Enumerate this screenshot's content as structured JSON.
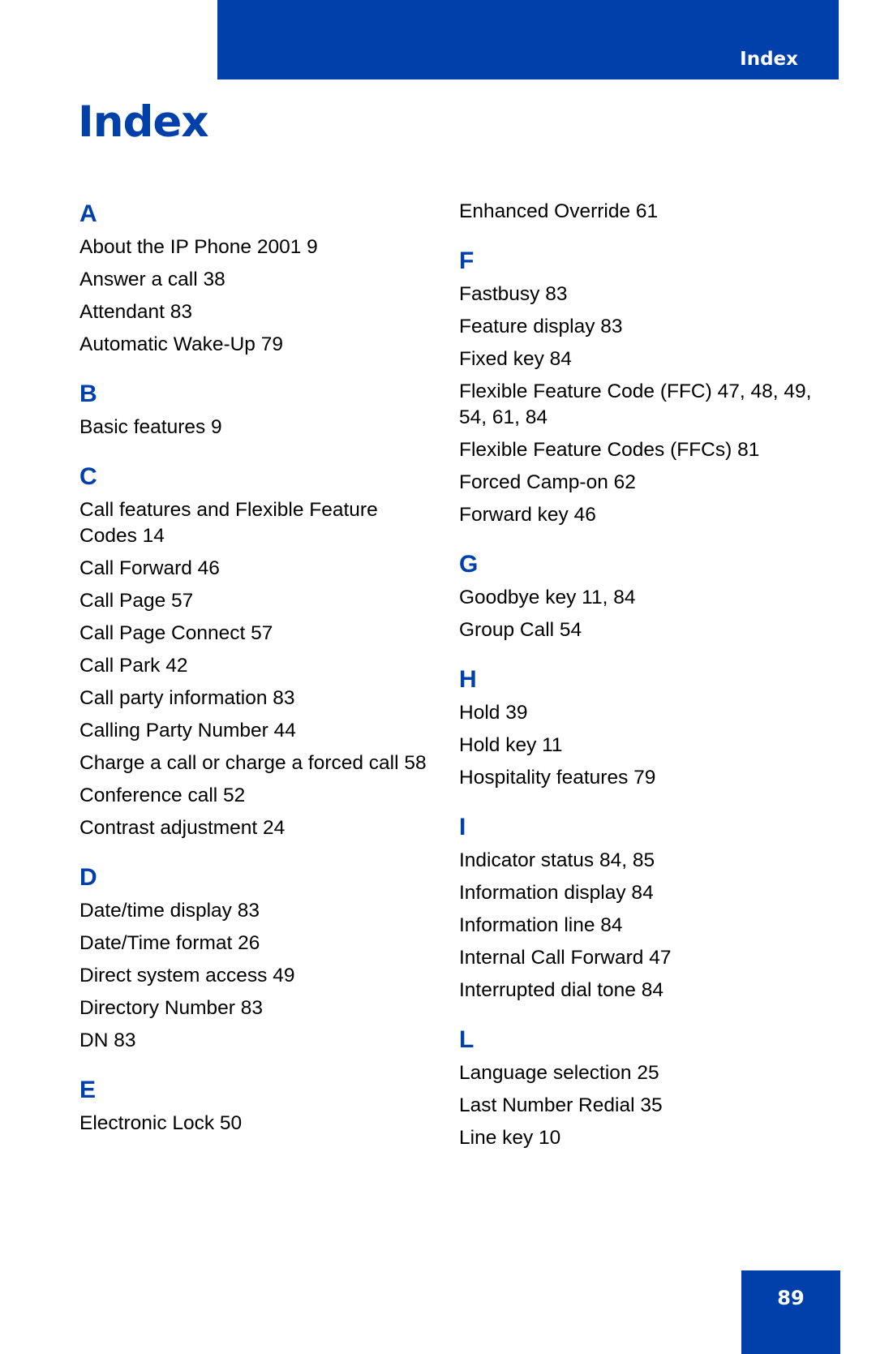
{
  "header": {
    "section_label": "Index"
  },
  "title": "Index",
  "page_number": "89",
  "colors": {
    "brand_blue": "#0040ab"
  },
  "left_column": [
    {
      "letter": "A",
      "entries": [
        "About the IP Phone 2001 9",
        "Answer a call 38",
        "Attendant 83",
        "Automatic Wake-Up 79"
      ]
    },
    {
      "letter": "B",
      "entries": [
        "Basic features 9"
      ]
    },
    {
      "letter": "C",
      "entries": [
        "Call features and Flexible Feature Codes 14",
        "Call Forward 46",
        "Call Page 57",
        "Call Page Connect 57",
        "Call Park 42",
        "Call party information 83",
        "Calling Party Number 44",
        "Charge a call or charge a forced call 58",
        "Conference call 52",
        "Contrast adjustment 24"
      ]
    },
    {
      "letter": "D",
      "entries": [
        "Date/time display 83",
        "Date/Time format 26",
        "Direct system access 49",
        "Directory Number 83",
        "DN 83"
      ]
    },
    {
      "letter": "E",
      "entries": [
        "Electronic Lock 50"
      ]
    }
  ],
  "right_column": [
    {
      "letter": "",
      "entries": [
        "Enhanced Override 61"
      ]
    },
    {
      "letter": "F",
      "entries": [
        "Fastbusy 83",
        "Feature display 83",
        "Fixed key 84",
        "Flexible Feature Code (FFC) 47, 48, 49, 54, 61, 84",
        "Flexible Feature Codes (FFCs) 81",
        "Forced Camp-on 62",
        "Forward key 46"
      ]
    },
    {
      "letter": "G",
      "entries": [
        "Goodbye key 11, 84",
        "Group Call 54"
      ]
    },
    {
      "letter": "H",
      "entries": [
        "Hold 39",
        "Hold key 11",
        "Hospitality features 79"
      ]
    },
    {
      "letter": "I",
      "entries": [
        "Indicator status 84, 85",
        "Information display 84",
        "Information line 84",
        "Internal Call Forward 47",
        "Interrupted dial tone 84"
      ]
    },
    {
      "letter": "L",
      "entries": [
        "Language selection 25",
        "Last Number Redial 35",
        "Line key 10"
      ]
    }
  ]
}
